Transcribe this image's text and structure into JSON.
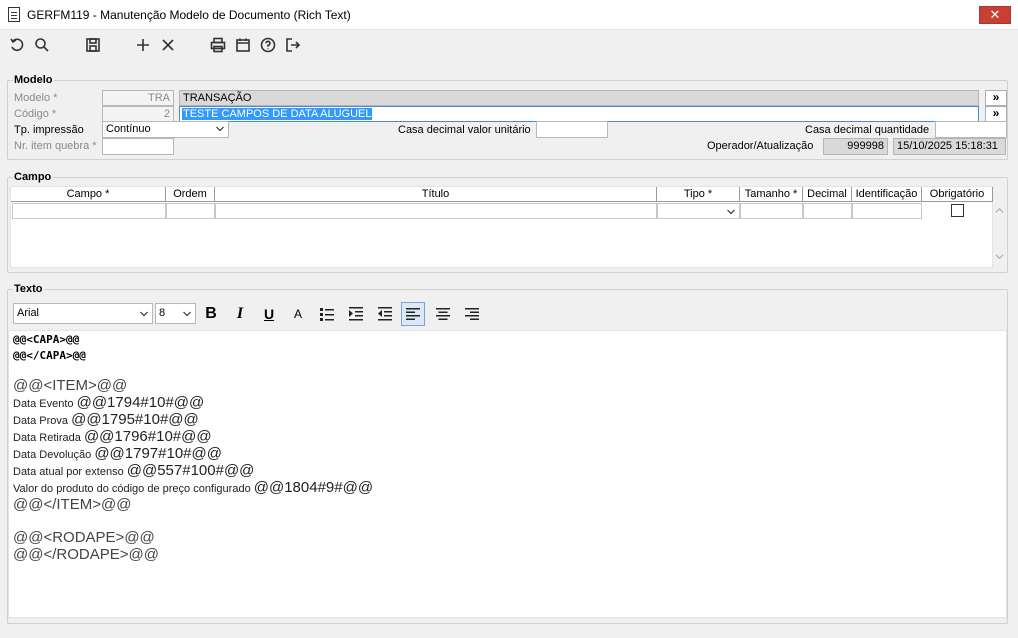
{
  "window": {
    "title": "GERFM119 - Manutenção Modelo de Documento (Rich Text)",
    "close_glyph": "✕"
  },
  "toolbar": {
    "icons": [
      "undo-icon",
      "search-icon",
      "save-icon",
      "add-icon",
      "delete-icon",
      "print-icon",
      "calendar-icon",
      "help-icon",
      "exit-icon"
    ]
  },
  "modelo": {
    "group_label": "Modelo",
    "modelo_label": "Modelo *",
    "modelo_value": "TRA",
    "modelo_desc": "TRANSAÇÃO",
    "codigo_label": "Código *",
    "codigo_value": "2",
    "codigo_desc": "TESTE CAMPOS DE DATA ALUGUEL",
    "more_glyph": "»",
    "tp_impressao_label": "Tp. impressão",
    "tp_impressao_value": "Contínuo",
    "casa_decimal_unit_label": "Casa decimal valor unitário",
    "casa_decimal_unit_value": "",
    "casa_decimal_qtd_label": "Casa decimal quantidade",
    "casa_decimal_qtd_value": "",
    "nr_item_quebra_label": "Nr. item quebra *",
    "nr_item_quebra_value": "",
    "operador_label": "Operador/Atualização",
    "operador_value": "999998",
    "atualizacao_value": "15/10/2025 15:18:31"
  },
  "campo": {
    "group_label": "Campo",
    "columns": [
      "Campo *",
      "Ordem",
      "Título",
      "Tipo *",
      "Tamanho *",
      "Decimal",
      "Identificação",
      "Obrigatório"
    ]
  },
  "texto": {
    "group_label": "Texto",
    "font_family": "Arial",
    "font_size": "8",
    "format_icons": [
      "bold-icon",
      "italic-icon",
      "underline-icon",
      "font-color-icon",
      "bullet-list-icon",
      "indent-icon",
      "outdent-icon",
      "align-left-icon",
      "align-center-icon",
      "align-right-icon"
    ],
    "glyphs": {
      "bold": "B",
      "italic": "I",
      "underline": "U",
      "color": "A"
    },
    "lines": {
      "capa_open": "@@<CAPA>@@",
      "capa_close": "@@</CAPA>@@",
      "item_open": "@@<ITEM>@@",
      "l1_label": "Data Evento ",
      "l1_code": "@@1794#10#@@",
      "l2_label": "Data Prova ",
      "l2_code": "@@1795#10#@@",
      "l3_label": "Data Retirada ",
      "l3_code": "@@1796#10#@@",
      "l4_label": "Data Devolução ",
      "l4_code": "@@1797#10#@@",
      "l5_label": "Data atual por extenso ",
      "l5_code": "@@557#100#@@",
      "l6_label": "Valor do produto do código de preço configurado ",
      "l6_code": "@@1804#9#@@",
      "item_close": "@@</ITEM>@@",
      "rodape_open": "@@<RODAPE>@@",
      "rodape_close": "@@</RODAPE>@@"
    }
  }
}
